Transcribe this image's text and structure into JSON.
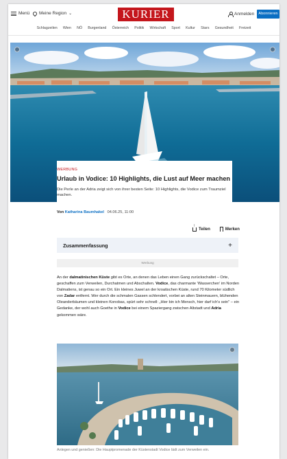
{
  "header": {
    "menu_label": "Menü",
    "region_label": "Meine Region",
    "logo": "KURIER",
    "login_label": "Anmelden",
    "subscribe_label": "Abonnieren"
  },
  "nav": [
    "Schlagzeilen",
    "Wien",
    "NÖ",
    "Burgenland",
    "Österreich",
    "Politik",
    "Wirtschaft",
    "Sport",
    "Kultur",
    "Stars",
    "Gesundheit",
    "Freizeit"
  ],
  "article": {
    "kicker": "WERBUNG",
    "headline": "Urlaub in Vodice: 10 Highlights, die Lust auf Meer machen",
    "lead": "Die Perle an der Adria zeigt sich von ihrer besten Seite: 10 Highlights, die Vodice zum Traumziel machen.",
    "byline_prefix": "Von",
    "author": "Katharina Baumhakel",
    "date": "04.06.25, 11:00",
    "share_label": "Teilen",
    "bookmark_label": "Merken",
    "summary_label": "Zusammenfassung",
    "ad_label": "Werbung",
    "paragraph": [
      {
        "t": "An der ",
        "b": false
      },
      {
        "t": "dalmatinischen Küste",
        "b": true
      },
      {
        "t": " gibt es Orte, an denen das Leben einen Gang zurückschaltet – Orte, geschaffen zum Verweilen, Durchatmen und Abschalten. ",
        "b": false
      },
      {
        "t": "Vodice",
        "b": true
      },
      {
        "t": ", das charmante 'Wasserchen' im Norden Dalmatiens, ist genau so ein Ort. Ein kleines Juwel an der kroatischen Küste, rund 70 Kilometer südlich von ",
        "b": false
      },
      {
        "t": "Zadar",
        "b": true
      },
      {
        "t": " entfernt. Wer durch die schmalen Gassen schlendert, vorbei an alten Steinmauern, blühenden Oleanderbäumen und kleinen Konobas, spürt sehr schnell: „Hier bin ich Mensch, hier darf ich's sein\" – ein Gedanke, der wohl auch Goethe in ",
        "b": false
      },
      {
        "t": "Vodice",
        "b": true
      },
      {
        "t": " bei einem Spaziergang zwischen Altstadt und ",
        "b": false
      },
      {
        "t": "Adria",
        "b": true
      },
      {
        "t": " gekommen wäre.",
        "b": false
      }
    ],
    "caption": "Anlegen und genießen: Die Hauptpromenade der Küstenstadt Vodice lädt zum Verweilen ein."
  },
  "colors": {
    "brand_red": "#c4161c",
    "accent_blue": "#0b6fc3",
    "summary_bg": "#eef2f8"
  },
  "icons": [
    "menu-icon",
    "location-pin-icon",
    "chevron-down-icon",
    "user-icon",
    "share-icon",
    "bookmark-icon",
    "plus-icon",
    "expand-icon"
  ]
}
